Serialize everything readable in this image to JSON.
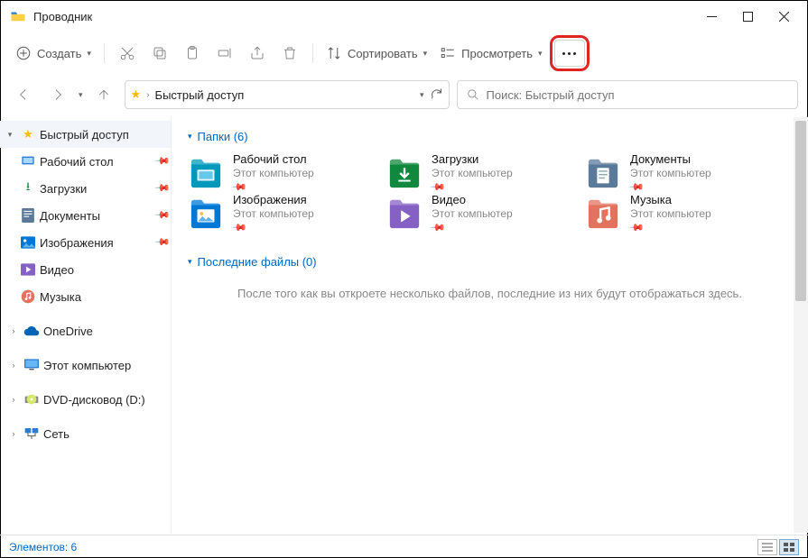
{
  "window": {
    "title": "Проводник"
  },
  "toolbar": {
    "create": "Создать",
    "sort": "Сортировать",
    "view": "Просмотреть"
  },
  "address": {
    "location": "Быстрый доступ"
  },
  "search": {
    "placeholder": "Поиск: Быстрый доступ"
  },
  "tree": {
    "quick": "Быстрый доступ",
    "desktop": "Рабочий стол",
    "downloads": "Загрузки",
    "documents": "Документы",
    "pictures": "Изображения",
    "videos": "Видео",
    "music": "Музыка",
    "onedrive": "OneDrive",
    "thispc": "Этот компьютер",
    "dvd": "DVD-дисковод (D:)",
    "network": "Сеть"
  },
  "groups": {
    "folders_label": "Папки (6)",
    "recent_label": "Последние файлы (0)",
    "empty_msg": "После того как вы откроете несколько файлов, последние из них будут отображаться здесь."
  },
  "folders": [
    {
      "name": "Рабочий стол",
      "sub": "Этот компьютер",
      "color": "#0099bc",
      "kind": "desktop"
    },
    {
      "name": "Загрузки",
      "sub": "Этот компьютер",
      "color": "#10893e",
      "kind": "downloads"
    },
    {
      "name": "Документы",
      "sub": "Этот компьютер",
      "color": "#5b7a99",
      "kind": "documents"
    },
    {
      "name": "Изображения",
      "sub": "Этот компьютер",
      "color": "#0078d4",
      "kind": "pictures"
    },
    {
      "name": "Видео",
      "sub": "Этот компьютер",
      "color": "#8661c5",
      "kind": "videos"
    },
    {
      "name": "Музыка",
      "sub": "Этот компьютер",
      "color": "#e3735e",
      "kind": "music"
    }
  ],
  "status": {
    "count_label": "Элементов: 6"
  }
}
